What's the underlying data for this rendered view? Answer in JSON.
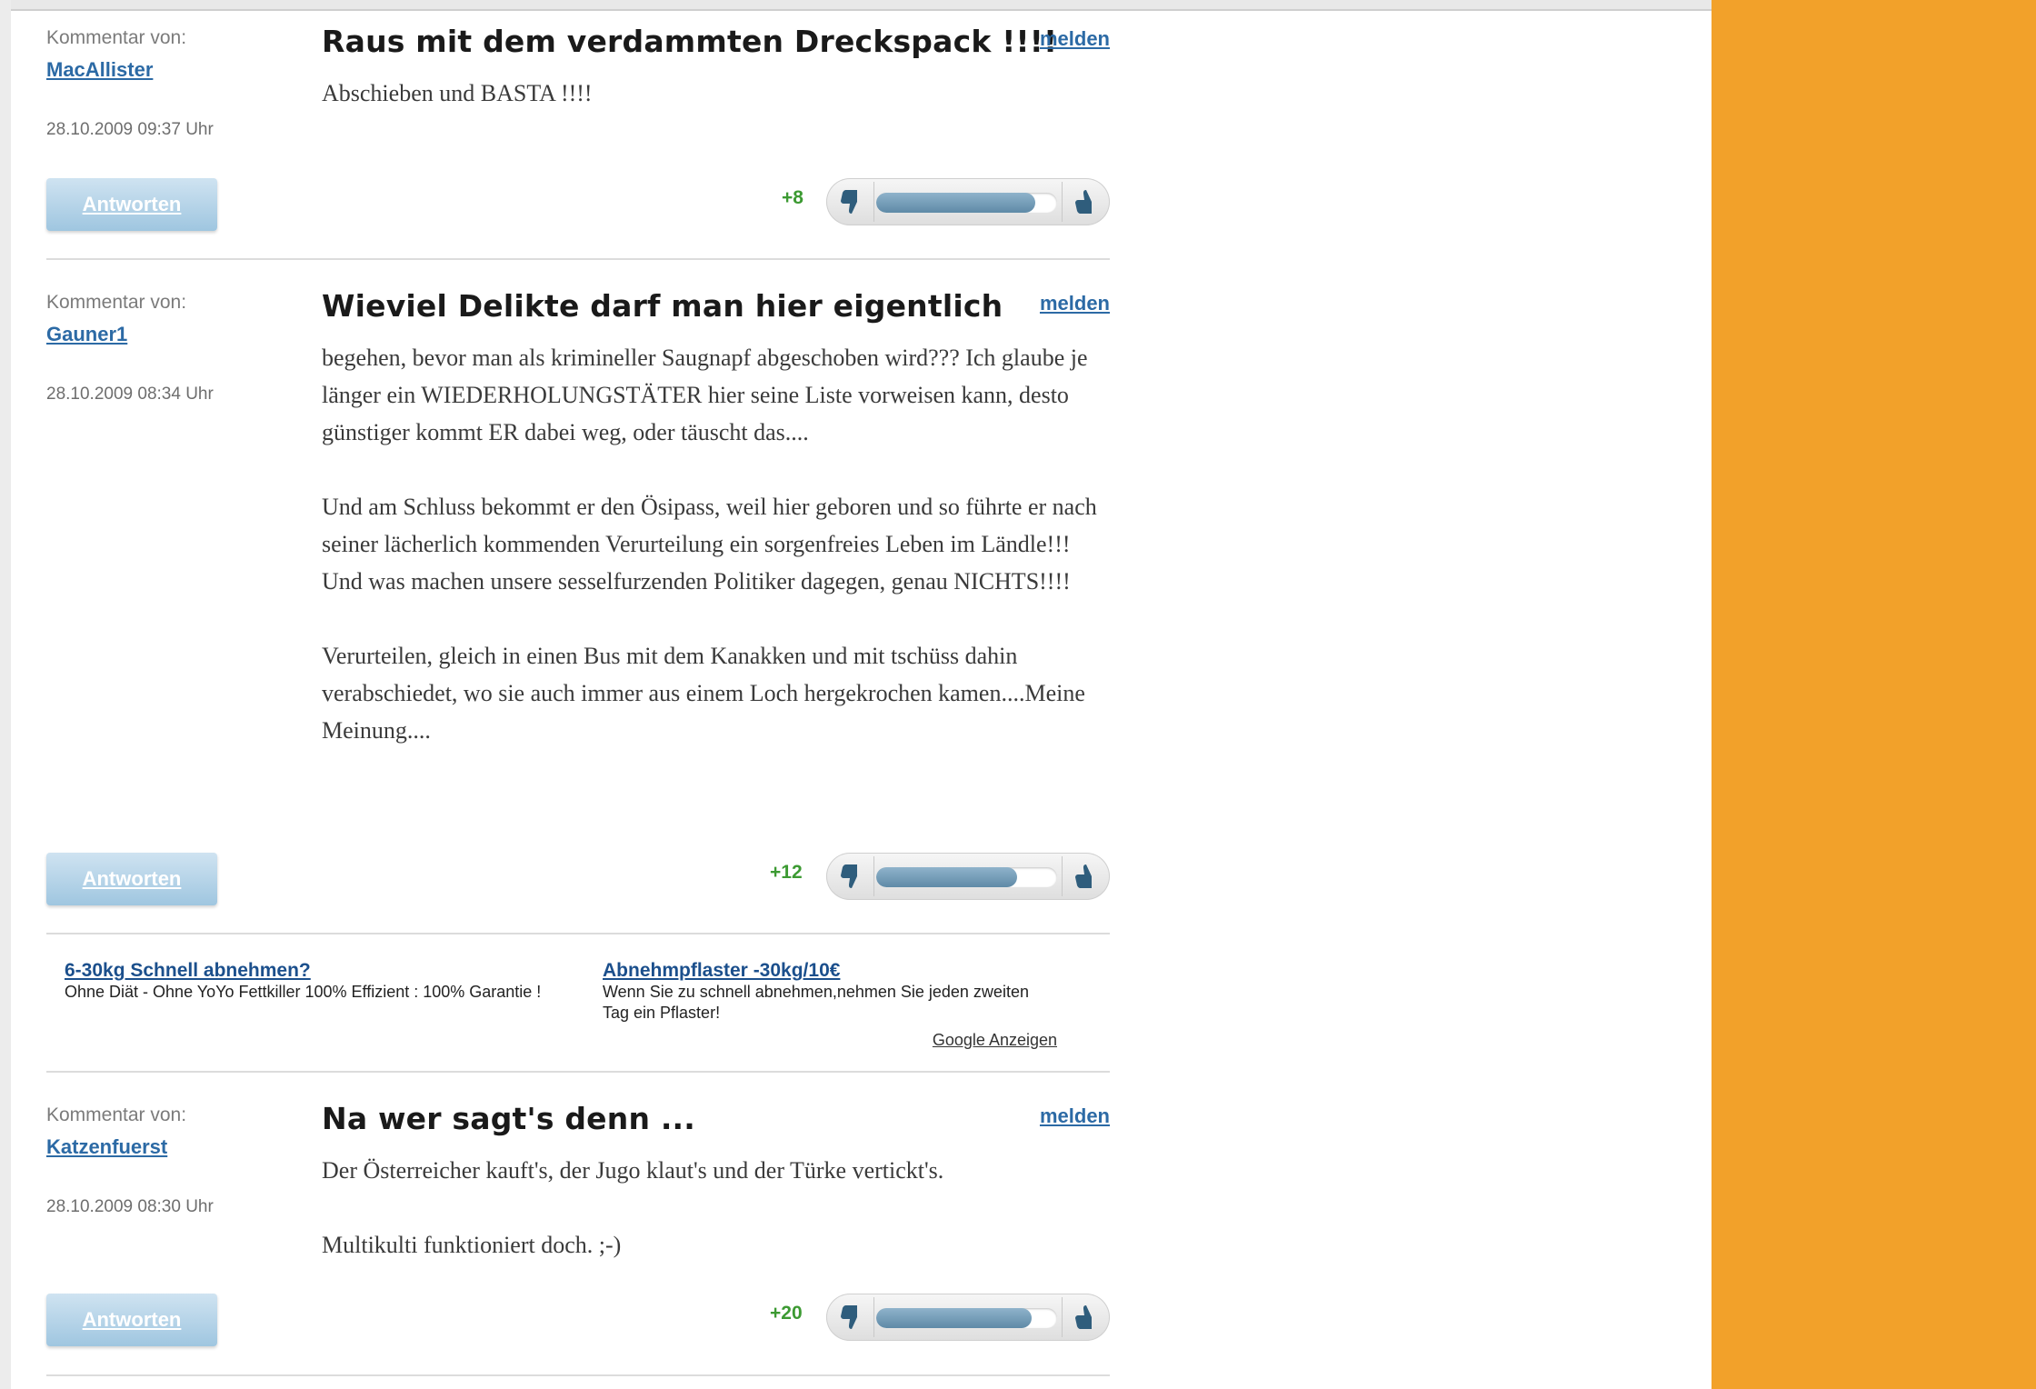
{
  "comments": [
    {
      "meta_label": "Kommentar von:",
      "author": "MacAllister",
      "date": "28.10.2009 09:37 Uhr",
      "title": "Raus mit dem verdammten Dreckspack !!!!",
      "report_label": "melden",
      "paragraphs": [
        "Abschieben und BASTA !!!!"
      ],
      "reply_label": "Antworten",
      "score": "+8",
      "vote_fill": 0.88
    },
    {
      "meta_label": "Kommentar von:",
      "author": "Gauner1",
      "date": "28.10.2009 08:34 Uhr",
      "title": "Wieviel Delikte darf man hier eigentlich",
      "report_label": "melden",
      "paragraphs": [
        "begehen, bevor man als krimineller Saugnapf abgeschoben wird??? Ich glaube je länger ein WIEDERHOLUNGSTÄTER hier seine Liste vorweisen kann, desto günstiger kommt ER dabei weg, oder täuscht das....",
        "Und am Schluss bekommt er den Ösipass, weil hier geboren und so führte er nach seiner lächerlich kommenden Verurteilung ein sorgenfreies Leben im Ländle!!! Und was machen unsere sesselfurzenden Politiker dagegen, genau NICHTS!!!!",
        "Verurteilen, gleich in einen Bus mit dem Kanakken und mit tschüss dahin verabschiedet, wo sie auch immer aus einem Loch hergekrochen kamen....Meine Meinung...."
      ],
      "reply_label": "Antworten",
      "score": "+12",
      "vote_fill": 0.78
    },
    {
      "meta_label": "Kommentar von:",
      "author": "Katzenfuerst",
      "date": "28.10.2009 08:30 Uhr",
      "title": "Na wer sagt's denn ...",
      "report_label": "melden",
      "paragraphs": [
        "Der Österreicher kauft's, der Jugo klaut's und der Türke vertickt's.",
        "Multikulti funktioniert doch. ;-)"
      ],
      "reply_label": "Antworten",
      "score": "+20",
      "vote_fill": 0.86
    }
  ],
  "ads": {
    "items": [
      {
        "title": "6-30kg Schnell abnehmen?",
        "text": "Ohne Diät - Ohne YoYo Fettkiller 100% Effizient : 100% Garantie !"
      },
      {
        "title": "Abnehmpflaster -30kg/10€",
        "text": "Wenn Sie zu schnell abnehmen,nehmen Sie jeden zweiten Tag ein Pflaster!"
      }
    ],
    "credit": "Google Anzeigen"
  },
  "colors": {
    "sidebar": "#f2a12a",
    "link": "#2c6aa5",
    "score": "#3c9a32"
  },
  "icons": {
    "vote_down": "thumbs-down-icon",
    "vote_up": "thumbs-up-icon"
  }
}
